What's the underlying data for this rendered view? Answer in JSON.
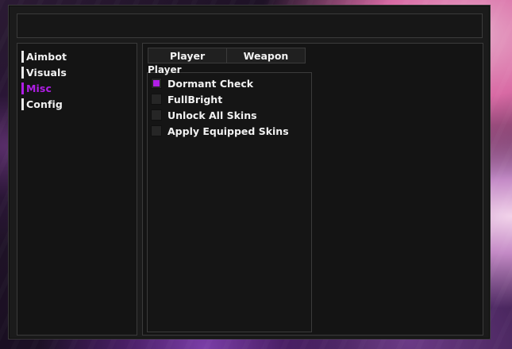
{
  "sidebar": {
    "items": [
      {
        "label": "Aimbot"
      },
      {
        "label": "Visuals"
      },
      {
        "label": "Misc"
      },
      {
        "label": "Config"
      }
    ],
    "active_index": 2
  },
  "tabs": [
    {
      "label": "Player"
    },
    {
      "label": "Weapon"
    }
  ],
  "group": {
    "title": "Player",
    "options": [
      {
        "label": "Dormant Check",
        "checked": true
      },
      {
        "label": "FullBright",
        "checked": false
      },
      {
        "label": "Unlock All Skins",
        "checked": false
      },
      {
        "label": "Apply Equipped Skins",
        "checked": false
      }
    ]
  },
  "colors": {
    "accent": "#b01ee6",
    "panel_bg": "#141414",
    "border": "#3b3b3b",
    "text": "#f1f1f1"
  }
}
